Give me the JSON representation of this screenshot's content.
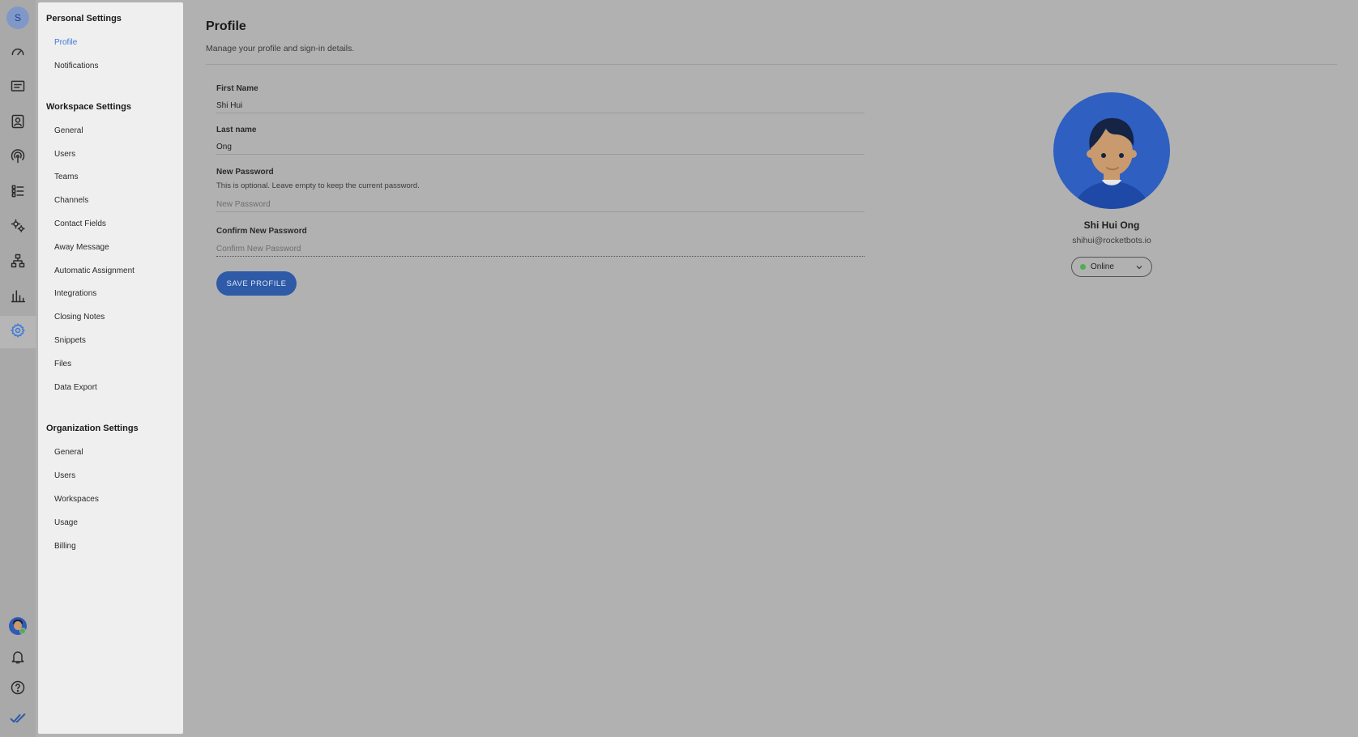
{
  "rail": {
    "workspace_initial": "S",
    "icons": [
      "dashboard-icon",
      "inbox-icon",
      "contacts-icon",
      "broadcast-icon",
      "workflows-icon",
      "automation-icon",
      "org-chart-icon",
      "reports-icon",
      "settings-icon"
    ],
    "bottom_icons": [
      "user-avatar-icon",
      "bell-icon",
      "help-icon",
      "double-check-icon"
    ]
  },
  "sidebar": {
    "personal_title": "Personal Settings",
    "personal_items": [
      "Profile",
      "Notifications"
    ],
    "workspace_title": "Workspace Settings",
    "workspace_items": [
      "General",
      "Users",
      "Teams",
      "Channels",
      "Contact Fields",
      "Away Message",
      "Automatic Assignment",
      "Integrations",
      "Closing Notes",
      "Snippets",
      "Files",
      "Data Export"
    ],
    "organization_title": "Organization Settings",
    "organization_items": [
      "General",
      "Users",
      "Workspaces",
      "Usage",
      "Billing"
    ]
  },
  "main": {
    "title": "Profile",
    "subtitle": "Manage your profile and sign-in details.",
    "first_name_label": "First Name",
    "first_name_value": "Shi Hui",
    "last_name_label": "Last name",
    "last_name_value": "Ong",
    "new_password_label": "New Password",
    "new_password_help": "This is optional. Leave empty to keep the current password.",
    "new_password_placeholder": "New Password",
    "confirm_password_label": "Confirm New Password",
    "confirm_password_placeholder": "Confirm New Password",
    "save_label": "SAVE PROFILE"
  },
  "profile": {
    "name": "Shi Hui Ong",
    "email": "shihui@rocketbots.io",
    "status": "Online"
  },
  "colors": {
    "accent": "#2e5aa7",
    "active_link": "#3f7ad6",
    "online": "#4caf50"
  }
}
